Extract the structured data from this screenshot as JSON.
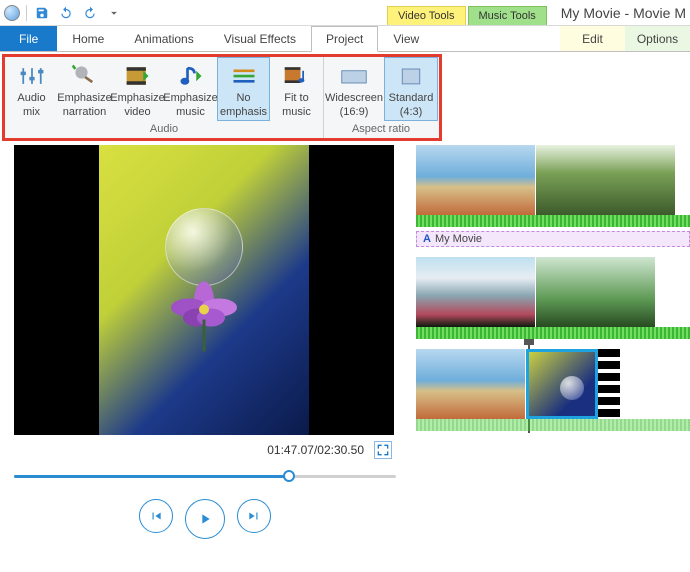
{
  "window": {
    "title": "My Movie - Movie M"
  },
  "tool_context": {
    "video": "Video Tools",
    "music": "Music Tools"
  },
  "tabs": {
    "file": "File",
    "home": "Home",
    "animations": "Animations",
    "visual_effects": "Visual Effects",
    "project": "Project",
    "view": "View",
    "edit": "Edit",
    "options": "Options",
    "active": "project"
  },
  "ribbon": {
    "audio": {
      "label": "Audio",
      "buttons": {
        "audio_mix": {
          "l1": "Audio",
          "l2": "mix"
        },
        "emph_narr": {
          "l1": "Emphasize",
          "l2": "narration"
        },
        "emph_video": {
          "l1": "Emphasize",
          "l2": "video"
        },
        "emph_music": {
          "l1": "Emphasize",
          "l2": "music"
        },
        "no_emph": {
          "l1": "No",
          "l2": "emphasis",
          "selected": true
        },
        "fit_music": {
          "l1": "Fit to",
          "l2": "music"
        }
      }
    },
    "aspect": {
      "label": "Aspect ratio",
      "buttons": {
        "widescreen": {
          "l1": "Widescreen",
          "l2": "(16:9)"
        },
        "standard": {
          "l1": "Standard",
          "l2": "(4:3)",
          "selected": true
        }
      }
    }
  },
  "player": {
    "current": "01:47.07",
    "total": "02:30.50",
    "sep": "/",
    "progress_pct": 72
  },
  "timeline": {
    "caption_text": "My Movie"
  },
  "colors": {
    "highlight_border": "#e43b2f",
    "accent": "#1979ca"
  }
}
